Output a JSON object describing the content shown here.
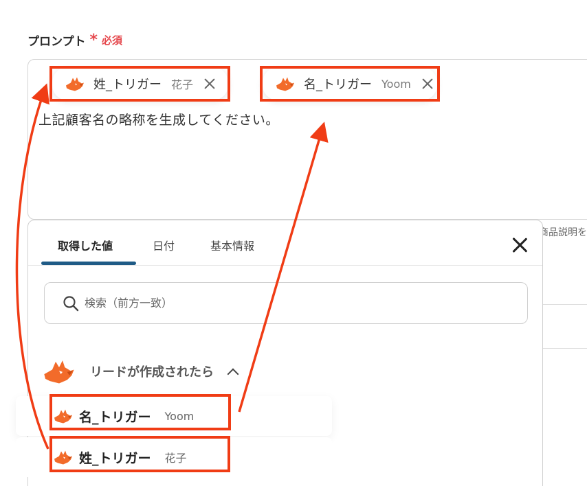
{
  "form": {
    "label": "プロンプト",
    "required_mark": "*",
    "required_text": "必須",
    "prompt_text": "上記顧客名の略称を生成してください。",
    "chips": [
      {
        "name": "姓_トリガー",
        "value": "花子"
      },
      {
        "name": "名_トリガー",
        "value": "Yoom"
      }
    ],
    "side_hint": "商品説明を"
  },
  "panel": {
    "tabs": [
      {
        "label": "取得した値",
        "active": true
      },
      {
        "label": "日付",
        "active": false
      },
      {
        "label": "基本情報",
        "active": false
      }
    ],
    "search_placeholder": "検索（前方一致）",
    "section_title": "リードが作成されたら",
    "items": [
      {
        "name": "名_トリガー",
        "value": "Yoom"
      },
      {
        "name": "姓_トリガー",
        "value": "花子"
      }
    ]
  },
  "colors": {
    "highlight": "#f03c15",
    "tab_underline": "#1f5b86",
    "required": "#e5484d",
    "fox": "#f26b2a"
  },
  "icons": {
    "chip_icon": "yoom-fox-icon",
    "remove_icon": "close-icon",
    "search_icon": "search-icon",
    "section_icon": "yoom-fox-icon",
    "collapse_icon": "chevron-up-icon",
    "panel_close_icon": "close-icon"
  }
}
